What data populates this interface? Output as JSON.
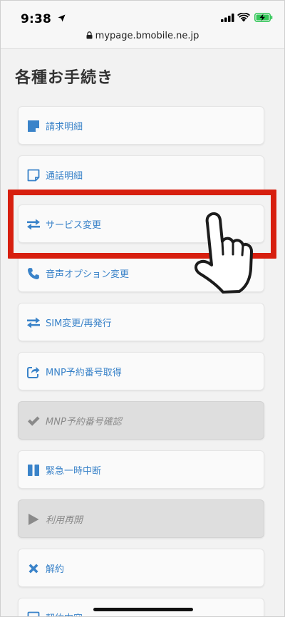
{
  "status_bar": {
    "time": "9:38"
  },
  "browser": {
    "url": "mypage.bmobile.ne.jp"
  },
  "page": {
    "title": "各種お手続き"
  },
  "menu": {
    "items": [
      {
        "label": "請求明細",
        "icon": "invoice-icon",
        "disabled": false
      },
      {
        "label": "通話明細",
        "icon": "note-icon",
        "disabled": false
      },
      {
        "label": "サービス変更",
        "icon": "exchange-arrows-icon",
        "disabled": false
      },
      {
        "label": "音声オプション変更",
        "icon": "phone-icon",
        "disabled": false
      },
      {
        "label": "SIM変更/再発行",
        "icon": "exchange-arrows-icon",
        "disabled": false
      },
      {
        "label": "MNP予約番号取得",
        "icon": "share-arrow-icon",
        "disabled": false
      },
      {
        "label": "MNP予約番号確認",
        "icon": "check-icon",
        "disabled": true
      },
      {
        "label": "緊急一時中断",
        "icon": "pause-icon",
        "disabled": false
      },
      {
        "label": "利用再開",
        "icon": "play-icon",
        "disabled": true
      },
      {
        "label": "解約",
        "icon": "cross-icon",
        "disabled": false
      },
      {
        "label": "契約内容",
        "icon": "document-icon",
        "disabled": false
      }
    ]
  },
  "colors": {
    "accent": "#3a83c9",
    "highlight": "#d71f0f",
    "disabled_text": "#8a8a8a"
  }
}
